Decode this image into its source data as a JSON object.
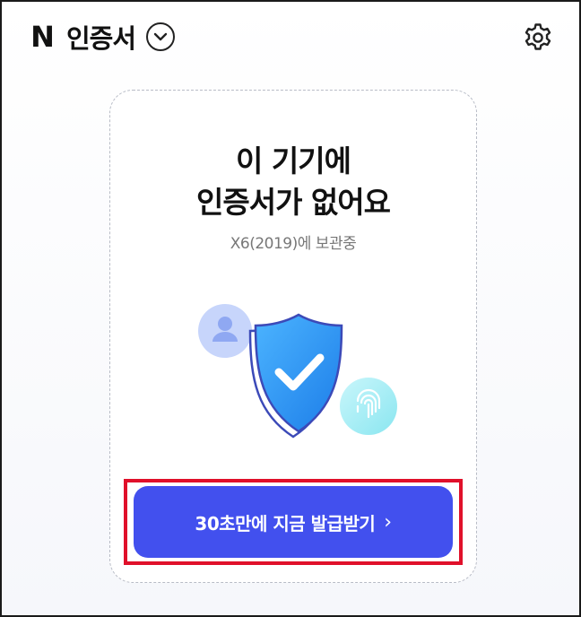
{
  "header": {
    "logo_letter": "N",
    "title": "인증서",
    "dropdown_icon": "chevron-down-icon",
    "settings_icon": "gear-icon"
  },
  "card": {
    "title_line1": "이 기기에",
    "title_line2": "인증서가 없어요",
    "subtitle": "X6(2019)에 보관중",
    "illustration": [
      "person-icon",
      "shield-check-icon",
      "fingerprint-icon"
    ],
    "cta_label": "30초만에 지금 발급받기",
    "cta_chevron": "›"
  },
  "colors": {
    "accent": "#4250ee",
    "highlight": "#e0102a",
    "shield": "#2f9bef",
    "title": "#111111",
    "subtitle": "#777777"
  }
}
